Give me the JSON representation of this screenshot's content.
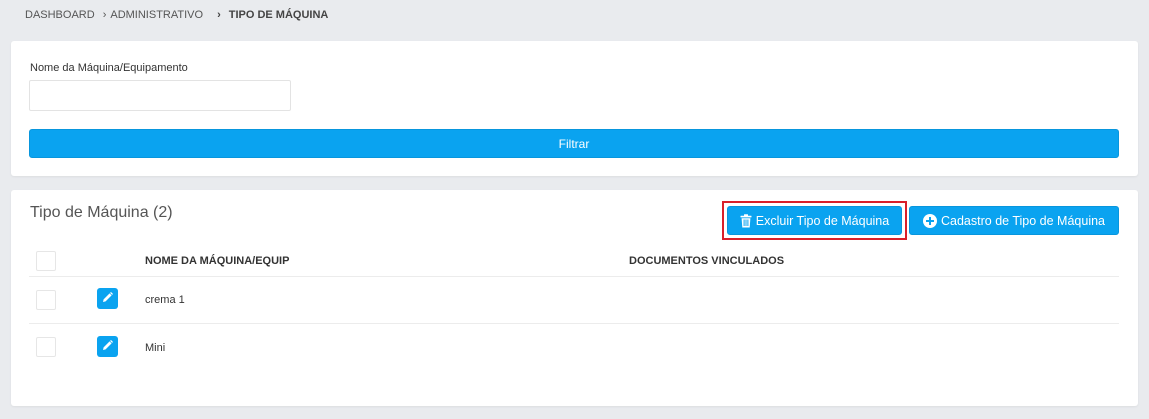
{
  "breadcrumb": {
    "items": [
      "DASHBOARD",
      "ADMINISTRATIVO"
    ],
    "separator": "›",
    "current": "TIPO DE MÁQUINA"
  },
  "filter": {
    "field_label": "Nome da Máquina/Equipamento",
    "field_value": "",
    "field_placeholder": "",
    "button_label": "Filtrar"
  },
  "list": {
    "title": "Tipo de Máquina (2)",
    "delete_button": {
      "label": "Excluir Tipo de Máquina",
      "icon": "trash-icon"
    },
    "create_button": {
      "label": "Cadastro de Tipo de Máquina",
      "icon": "plus-circle-icon"
    },
    "columns": [
      "NOME DA MÁQUINA/EQUIP",
      "DOCUMENTOS VINCULADOS"
    ],
    "rows": [
      {
        "name": "crema 1",
        "documents": "",
        "edit_icon": "pencil-icon"
      },
      {
        "name": "Mini",
        "documents": "",
        "edit_icon": "pencil-icon"
      }
    ]
  },
  "colors": {
    "primary": "#0aa3f0",
    "highlight_border": "#d9202a",
    "background": "#e9ebee"
  }
}
